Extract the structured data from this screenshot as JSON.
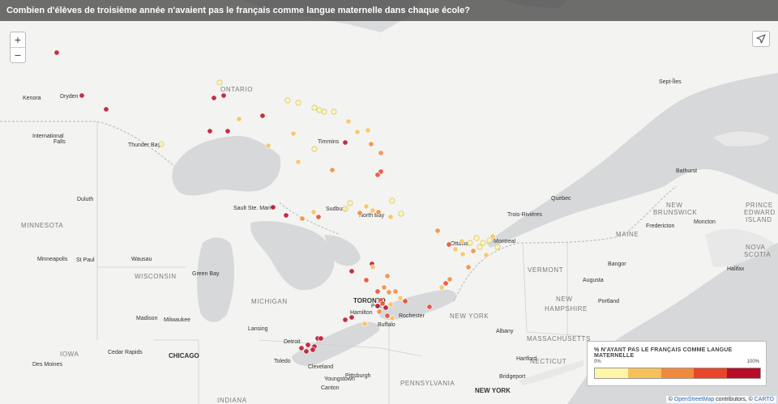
{
  "title": "Combien d'élèves de troisième année n'avaient pas le français comme langue maternelle dans chaque école?",
  "controls": {
    "zoom_in": "+",
    "zoom_out": "−"
  },
  "legend": {
    "title": "% N'AYANT PAS LE FRANÇAIS COMME LANGUE MATERNELLE",
    "min_label": "0%",
    "max_label": "100%",
    "colors": [
      "#fff5a8",
      "#f7c15a",
      "#f08a3c",
      "#e8452a",
      "#b80d27"
    ]
  },
  "attribution": {
    "prefix": "© ",
    "osm": "OpenStreetMap",
    "mid": " contributors, © ",
    "carto": "CARTO"
  },
  "labels": {
    "cities": [
      {
        "text": "Kenora"
      },
      {
        "text": "Dryden"
      },
      {
        "text": "International"
      },
      {
        "text": "Falls"
      },
      {
        "text": "Thunder Bay"
      },
      {
        "text": "Timmins"
      },
      {
        "text": "Duluth"
      },
      {
        "text": "Sault Ste. Marie"
      },
      {
        "text": "Sudbury"
      },
      {
        "text": "North Bay"
      },
      {
        "text": "Ottawa"
      },
      {
        "text": "Montreal"
      },
      {
        "text": "Quebec"
      },
      {
        "text": "Trois-Rivières"
      },
      {
        "text": "Sept-Îles"
      },
      {
        "text": "Bathurst"
      },
      {
        "text": "Fredericton"
      },
      {
        "text": "Moncton"
      },
      {
        "text": "Halifax"
      },
      {
        "text": "Bangor"
      },
      {
        "text": "Augusta"
      },
      {
        "text": "Portland"
      },
      {
        "text": "Minneapolis"
      },
      {
        "text": "St Paul"
      },
      {
        "text": "Wausau"
      },
      {
        "text": "Green Bay"
      },
      {
        "text": "Madison"
      },
      {
        "text": "Milwaukee"
      },
      {
        "text": "Cedar Rapids"
      },
      {
        "text": "Des Moines"
      },
      {
        "text": "Lansing"
      },
      {
        "text": "Detroit"
      },
      {
        "text": "Toledo"
      },
      {
        "text": "Cleveland"
      },
      {
        "text": "Youngstown"
      },
      {
        "text": "Canton"
      },
      {
        "text": "Pittsburgh"
      },
      {
        "text": "Hamilton"
      },
      {
        "text": "Buffalo"
      },
      {
        "text": "Rochester"
      },
      {
        "text": "Albany"
      },
      {
        "text": "Hartford"
      },
      {
        "text": "Bridgeport"
      },
      {
        "text": "Port"
      }
    ],
    "big_cities": [
      {
        "text": "TORONTO"
      },
      {
        "text": "CHICAGO"
      },
      {
        "text": "NEW YORK"
      }
    ],
    "regions": [
      {
        "text": "ONTARIO"
      },
      {
        "text": "MINNESOTA"
      },
      {
        "text": "WISCONSIN"
      },
      {
        "text": "MICHIGAN"
      },
      {
        "text": "IOWA"
      },
      {
        "text": "INDIANA"
      },
      {
        "text": "PENNSYLVANIA"
      },
      {
        "text": "NEW YORK"
      },
      {
        "text": "VERMONT"
      },
      {
        "text": "NEW"
      },
      {
        "text": "HAMPSHIRE"
      },
      {
        "text": "MAINE"
      },
      {
        "text": "MASSACHUSETTS"
      },
      {
        "text": "NECTICUT"
      },
      {
        "text": "NEW"
      },
      {
        "text": "BRUNSWICK"
      },
      {
        "text": "PRINCE"
      },
      {
        "text": "EDWARD"
      },
      {
        "text": "ISLAND"
      },
      {
        "text": "NOVA"
      },
      {
        "text": "SCOTIA"
      }
    ]
  },
  "schools": [
    {
      "c": 4
    },
    {
      "c": 4
    },
    {
      "c": 4
    },
    {
      "c": 4
    },
    {
      "c": 4
    },
    {
      "c": 4
    },
    {
      "c": 4
    },
    {
      "c": 4
    },
    {
      "c": 0
    },
    {
      "c": 0
    },
    {
      "c": 0
    },
    {
      "c": 0
    },
    {
      "c": 0
    },
    {
      "c": 0
    },
    {
      "c": 0
    },
    {
      "c": 1
    },
    {
      "c": 1
    },
    {
      "c": 1
    },
    {
      "c": 1
    },
    {
      "c": 2
    },
    {
      "c": 2
    },
    {
      "c": 1
    },
    {
      "c": 1
    },
    {
      "c": 0
    },
    {
      "c": 0
    },
    {
      "c": 1
    },
    {
      "c": 4
    },
    {
      "c": 2
    },
    {
      "c": 3
    },
    {
      "c": 3
    },
    {
      "c": 0
    },
    {
      "c": 0
    },
    {
      "c": 0
    },
    {
      "c": 1
    },
    {
      "c": 1
    },
    {
      "c": 2
    },
    {
      "c": 2
    },
    {
      "c": 1
    },
    {
      "c": 0
    },
    {
      "c": 2
    },
    {
      "c": 4
    },
    {
      "c": 4
    },
    {
      "c": 3
    },
    {
      "c": 1
    },
    {
      "c": 4
    },
    {
      "c": 4
    },
    {
      "c": 3
    },
    {
      "c": 2
    },
    {
      "c": 1
    },
    {
      "c": 2
    },
    {
      "c": 2
    },
    {
      "c": 3
    },
    {
      "c": 3
    },
    {
      "c": 2
    },
    {
      "c": 1
    },
    {
      "c": 1
    },
    {
      "c": 2
    },
    {
      "c": 3
    },
    {
      "c": 4
    },
    {
      "c": 4
    },
    {
      "c": 3
    },
    {
      "c": 4
    },
    {
      "c": 4
    },
    {
      "c": 1
    },
    {
      "c": 1
    },
    {
      "c": 4
    },
    {
      "c": 4
    },
    {
      "c": 4
    },
    {
      "c": 4
    },
    {
      "c": 4
    },
    {
      "c": 4
    },
    {
      "c": 4
    },
    {
      "c": 3
    },
    {
      "c": 3
    },
    {
      "c": 3
    },
    {
      "c": 2
    },
    {
      "c": 2
    },
    {
      "c": 1
    },
    {
      "c": 1
    },
    {
      "c": 0
    },
    {
      "c": 0
    },
    {
      "c": 0
    },
    {
      "c": 1
    },
    {
      "c": 0
    },
    {
      "c": 0
    },
    {
      "c": 1
    },
    {
      "c": 2
    },
    {
      "c": 1
    },
    {
      "c": 0
    },
    {
      "c": 2
    },
    {
      "c": 1
    },
    {
      "c": 3
    }
  ]
}
